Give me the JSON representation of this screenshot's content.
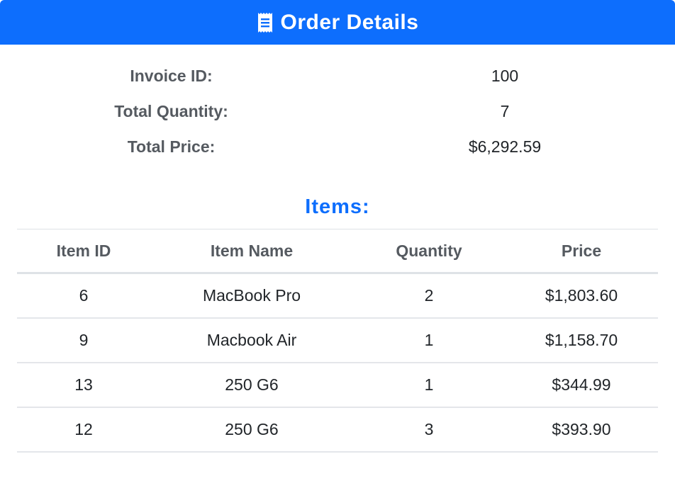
{
  "header": {
    "icon": "receipt-icon",
    "title": "Order Details",
    "color": "#0d6efd"
  },
  "summary": [
    {
      "label": "Invoice ID:",
      "value": "100"
    },
    {
      "label": "Total Quantity:",
      "value": "7"
    },
    {
      "label": "Total Price:",
      "value": "$6,292.59"
    }
  ],
  "items_section": {
    "title": "Items:",
    "columns": [
      "Item ID",
      "Item Name",
      "Quantity",
      "Price"
    ],
    "rows": [
      [
        "6",
        "MacBook Pro",
        "2",
        "$1,803.60"
      ],
      [
        "9",
        "Macbook Air",
        "1",
        "$1,158.70"
      ],
      [
        "13",
        "250 G6",
        "1",
        "$344.99"
      ],
      [
        "12",
        "250 G6",
        "3",
        "$393.90"
      ]
    ]
  }
}
